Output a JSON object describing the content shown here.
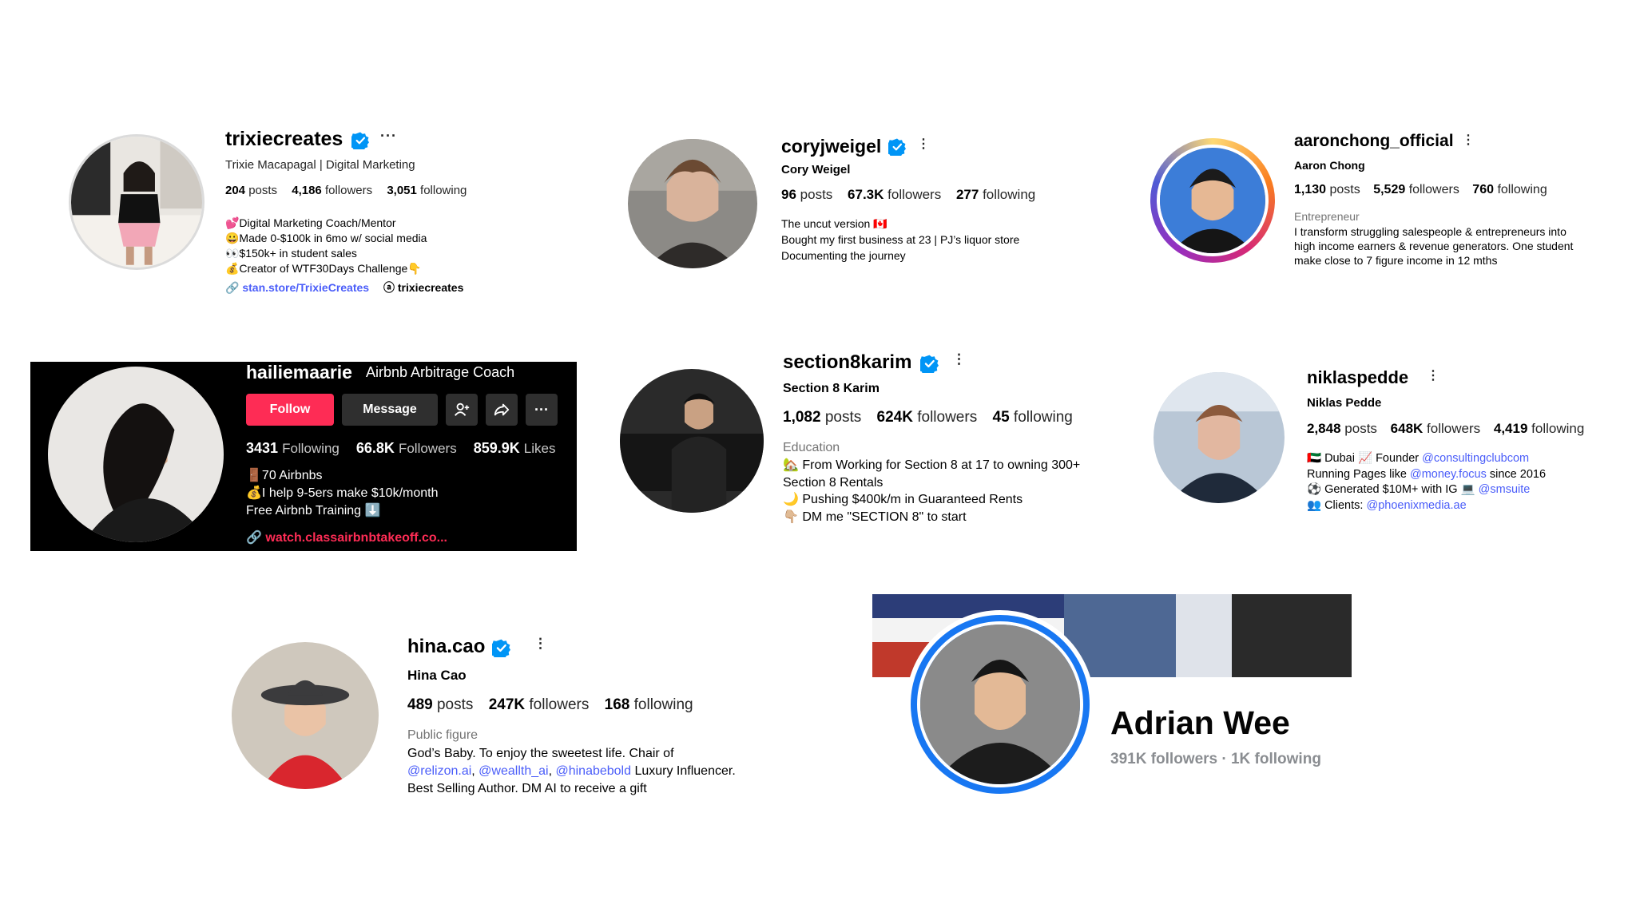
{
  "profiles": {
    "trixie": {
      "username": "trixiecreates",
      "fullname": "Trixie Macapagal | Digital Marketing",
      "posts_n": "204",
      "posts_l": "posts",
      "followers_n": "4,186",
      "followers_l": "followers",
      "following_n": "3,051",
      "following_l": "following",
      "bio": [
        "💕Digital Marketing Coach/Mentor",
        "😀Made 0-$100k in 6mo w/ social media",
        "👀$150k+ in student sales",
        "💰Creator of WTF30Days Challenge👇"
      ],
      "link": "stan.store/TrixieCreates",
      "threads": "trixiecreates"
    },
    "cory": {
      "username": "coryjweigel",
      "fullname": "Cory Weigel",
      "posts_n": "96",
      "posts_l": "posts",
      "followers_n": "67.3K",
      "followers_l": "followers",
      "following_n": "277",
      "following_l": "following",
      "bio": [
        "The uncut version 🇨🇦",
        "Bought my first business at 23 | PJ’s liquor store",
        "Documenting the journey"
      ]
    },
    "aaron": {
      "username": "aaronchong_official",
      "fullname": "Aaron Chong",
      "posts_n": "1,130",
      "posts_l": "posts",
      "followers_n": "5,529",
      "followers_l": "followers",
      "following_n": "760",
      "following_l": "following",
      "category": "Entrepreneur",
      "bio": [
        "I transform struggling salespeople & entrepreneurs into",
        "high income earners & revenue generators. One student",
        "make close to 7 figure income in 12 mths"
      ]
    },
    "hailie": {
      "username": "hailiemaarie",
      "title": "Airbnb Arbitrage Coach",
      "follow": "Follow",
      "message": "Message",
      "following_n": "3431",
      "following_l": "Following",
      "followers_n": "66.8K",
      "followers_l": "Followers",
      "likes_n": "859.9K",
      "likes_l": "Likes",
      "bio": [
        "🚪70 Airbnbs",
        "💰I help 9-5ers make $10k/month",
        "Free Airbnb Training ⬇️"
      ],
      "link": "watch.classairbnbtakeoff.co..."
    },
    "karim": {
      "username": "section8karim",
      "fullname": "Section 8 Karim",
      "posts_n": "1,082",
      "posts_l": "posts",
      "followers_n": "624K",
      "followers_l": "followers",
      "following_n": "45",
      "following_l": "following",
      "category": "Education",
      "bio": [
        "🏡 From Working for Section 8 at 17 to owning 300+",
        "Section 8 Rentals",
        "🌙 Pushing $400k/m in Guaranteed Rents",
        "👇🏼 DM me \"SECTION 8\" to start"
      ]
    },
    "niklas": {
      "username": "niklaspedde",
      "fullname": "Niklas Pedde",
      "posts_n": "2,848",
      "posts_l": "posts",
      "followers_n": "648K",
      "followers_l": "followers",
      "following_n": "4,419",
      "following_l": "following",
      "bio1_a": "🇦🇪 Dubai 📈 Founder ",
      "bio1_m": "@consultingclubcom",
      "bio2_a": "Running Pages like ",
      "bio2_m": "@money.focus",
      "bio2_b": " since 2016",
      "bio3_a": "⚽ Generated $10M+ with IG 💻 ",
      "bio3_m": "@smsuite",
      "bio4_a": "👥 Clients: ",
      "bio4_m": "@phoenixmedia.ae"
    },
    "hina": {
      "username": "hina.cao",
      "fullname": "Hina Cao",
      "posts_n": "489",
      "posts_l": "posts",
      "followers_n": "247K",
      "followers_l": "followers",
      "following_n": "168",
      "following_l": "following",
      "category": "Public figure",
      "bio1": "God’s Baby. To enjoy the sweetest life. Chair of",
      "m1": "@relizon.ai",
      "sep": ", ",
      "m2": "@weallth_ai",
      "m3": "@hinabebold",
      "bio2_b": " Luxury Influencer.",
      "bio3": "Best Selling Author. DM AI to receive a gift"
    },
    "adrian": {
      "name": "Adrian Wee",
      "stats": "391K followers · 1K following"
    }
  },
  "colors": {
    "verified": "#0095f6",
    "tiktok_red": "#fe2c55",
    "mention": "#4a5df9",
    "fb_blue": "#1877f2"
  }
}
